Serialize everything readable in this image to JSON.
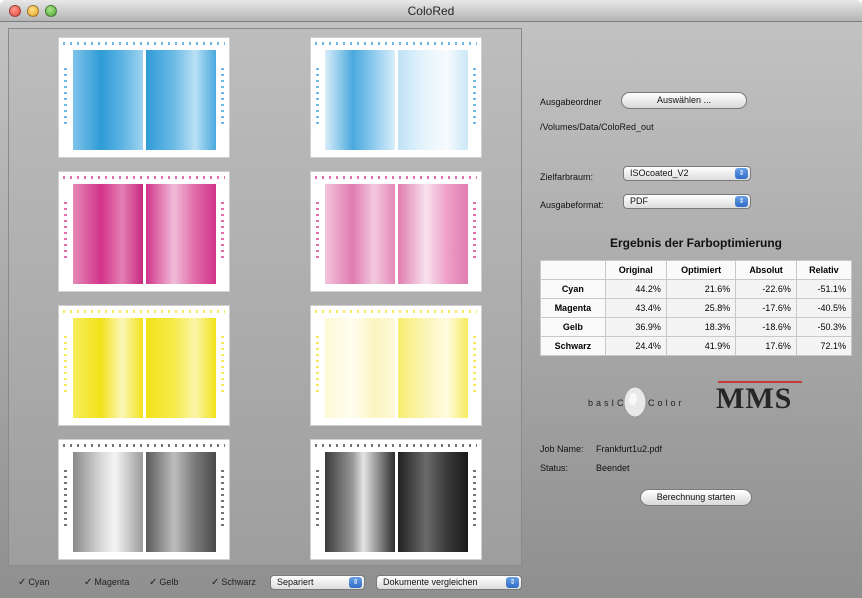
{
  "window": {
    "title": "ColoRed"
  },
  "output": {
    "folder_label": "Ausgabeordner",
    "choose_button": "Auswählen ...",
    "path": "/Volumes/Data/ColoRed_out"
  },
  "settings": {
    "target_colorspace_label": "Zielfarbraum:",
    "target_colorspace_value": "ISOcoated_V2",
    "output_format_label": "Ausgabeformat:",
    "output_format_value": "PDF"
  },
  "results": {
    "title": "Ergebnis der Farboptimierung",
    "columns": [
      "",
      "Original",
      "Optimiert",
      "Absolut",
      "Relativ"
    ],
    "rows": [
      {
        "name": "Cyan",
        "original": "44.2%",
        "optimized": "21.6%",
        "absolute": "-22.6%",
        "relative": "-51.1%"
      },
      {
        "name": "Magenta",
        "original": "43.4%",
        "optimized": "25.8%",
        "absolute": "-17.6%",
        "relative": "-40.5%"
      },
      {
        "name": "Gelb",
        "original": "36.9%",
        "optimized": "18.3%",
        "absolute": "-18.6%",
        "relative": "-50.3%"
      },
      {
        "name": "Schwarz",
        "original": "24.4%",
        "optimized": "41.9%",
        "absolute": "17.6%",
        "relative": "72.1%"
      }
    ]
  },
  "logos": {
    "basic_color": "basICColor",
    "mms": "MMS"
  },
  "job": {
    "name_label": "Job Name:",
    "name_value": "Frankfurt1u2.pdf",
    "status_label": "Status:",
    "status_value": "Beendet",
    "start_button": "Berechnung starten"
  },
  "bottom": {
    "checkboxes": [
      {
        "label": "Cyan",
        "checked": true
      },
      {
        "label": "Magenta",
        "checked": true
      },
      {
        "label": "Gelb",
        "checked": true
      },
      {
        "label": "Schwarz",
        "checked": true
      }
    ],
    "check_glyph": "✓",
    "mode_popup": "Separiert",
    "compare_popup": "Dokumente vergleichen"
  },
  "colors": {
    "cyan": "#2f9bd6",
    "magenta": "#d2338a",
    "yellow": "#f2e21a",
    "black": "#3a3a3a"
  }
}
